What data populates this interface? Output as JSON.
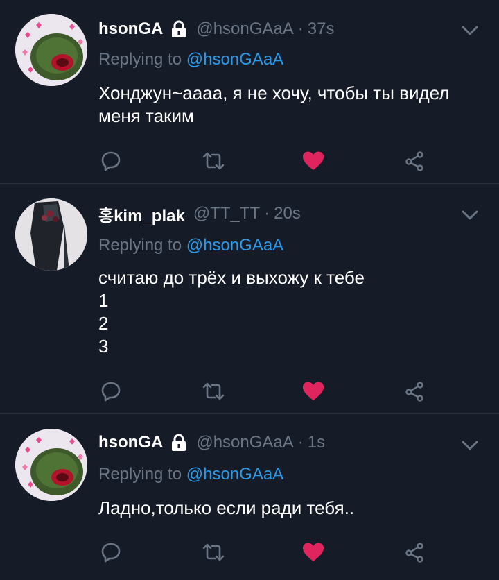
{
  "colors": {
    "background": "#151b27",
    "name": "#ffffff",
    "meta": "#6a7585",
    "mention": "#2a9ae8",
    "like": "#e0245e"
  },
  "tweets": [
    {
      "name": "hsonGA",
      "locked": true,
      "handle": "@hsonGAaA",
      "time": "37s",
      "replying_prefix": "Replying to ",
      "replying_to": "@hsonGAaA",
      "lines": [
        "Хонджун~аааа, я не хочу, чтобы ты видел",
        "меня таким"
      ],
      "liked": true,
      "icons": [
        "chevron-down-icon",
        "lock-icon",
        "reply-icon",
        "retweet-icon",
        "heart-icon",
        "share-icon"
      ]
    },
    {
      "name": "홍kim_plak",
      "locked": false,
      "handle": "@TT_TT",
      "time": "20s",
      "replying_prefix": "Replying to ",
      "replying_to": "@hsonGAaA",
      "lines": [
        "считаю до трёх и выхожу к тебе",
        "1",
        "2",
        "3"
      ],
      "liked": true
    },
    {
      "name": "hsonGA",
      "locked": true,
      "handle": "@hsonGAaA",
      "time": "1s",
      "replying_prefix": "Replying to ",
      "replying_to": "@hsonGAaA",
      "lines": [
        "Ладно,только если ради тебя.."
      ],
      "liked": true
    }
  ]
}
